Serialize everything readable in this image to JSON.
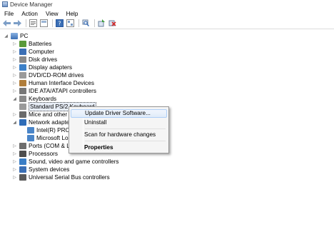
{
  "window": {
    "title": "Device Manager"
  },
  "menu": [
    "File",
    "Action",
    "View",
    "Help"
  ],
  "toolbar": {
    "buttons": [
      "back-arrow-icon",
      "forward-arrow-icon",
      "properties-icon",
      "show-hide-icon",
      "help-icon",
      "device-view-icon",
      "scan-icon",
      "update-driver-icon",
      "uninstall-icon"
    ]
  },
  "tree": {
    "root": "PC",
    "items": [
      {
        "label": "Batteries",
        "icon": "battery-icon",
        "color": "#5a9a3a"
      },
      {
        "label": "Computer",
        "icon": "computer-icon",
        "color": "#3b6fb5"
      },
      {
        "label": "Disk drives",
        "icon": "disk-drive-icon",
        "color": "#8a8a8a"
      },
      {
        "label": "Display adapters",
        "icon": "display-adapter-icon",
        "color": "#3c80c8"
      },
      {
        "label": "DVD/CD-ROM drives",
        "icon": "dvd-icon",
        "color": "#9a9a9a"
      },
      {
        "label": "Human Interface Devices",
        "icon": "hid-icon",
        "color": "#b07d3a"
      },
      {
        "label": "IDE ATA/ATAPI controllers",
        "icon": "ide-icon",
        "color": "#777777"
      },
      {
        "label": "Keyboards",
        "icon": "keyboard-icon",
        "color": "#8a8a8a",
        "expanded": true,
        "children": [
          {
            "label": "Standard PS/2 Keyboard",
            "icon": "keyboard-icon",
            "selected": true
          }
        ]
      },
      {
        "label": "Mice and other po",
        "icon": "mouse-icon",
        "color": "#6a6a6a"
      },
      {
        "label": "Network adapters",
        "icon": "network-icon",
        "color": "#2f6db8",
        "expanded": true,
        "children": [
          {
            "label": "Intel(R) PRO/1(",
            "icon": "network-icon"
          },
          {
            "label": "Microsoft Loop",
            "icon": "network-icon"
          }
        ]
      },
      {
        "label": "Ports (COM & LPT",
        "icon": "port-icon",
        "color": "#6d6d6d"
      },
      {
        "label": "Processors",
        "icon": "processor-icon",
        "color": "#4d4d4d"
      },
      {
        "label": "Sound, video and game controllers",
        "icon": "sound-icon",
        "color": "#3a7ec6"
      },
      {
        "label": "System devices",
        "icon": "system-icon",
        "color": "#3b6fb5"
      },
      {
        "label": "Universal Serial Bus controllers",
        "icon": "usb-icon",
        "color": "#5a5a5a"
      }
    ]
  },
  "context_menu": {
    "items": [
      {
        "label": "Update Driver Software...",
        "highlighted": true
      },
      {
        "label": "Uninstall"
      },
      {
        "label": "Scan for hardware changes"
      },
      {
        "label": "Properties",
        "bold": true
      }
    ]
  }
}
